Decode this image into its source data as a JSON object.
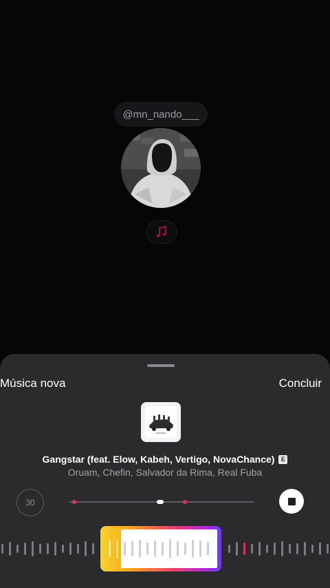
{
  "profile": {
    "username": "@mn_nando___"
  },
  "sheet": {
    "title": "Música nova",
    "done_label": "Concluir"
  },
  "track": {
    "title": "Gangstar (feat. Elow, Kabeh, Vertigo, NovaChance)",
    "explicit_badge": "E",
    "artists": "Oruam, Chefin, Salvador da Rima, Real Fuba"
  },
  "controls": {
    "duration_seconds": "30",
    "playback_state": "playing"
  },
  "icons": {
    "music_note": "music-note-icon",
    "stop": "stop-icon"
  },
  "colors": {
    "accent_pink": "#e02a6a",
    "sheet_background": "#2b2b2d",
    "selection_gradient_start": "#f7d52c",
    "selection_gradient_end": "#6a3cf0"
  }
}
